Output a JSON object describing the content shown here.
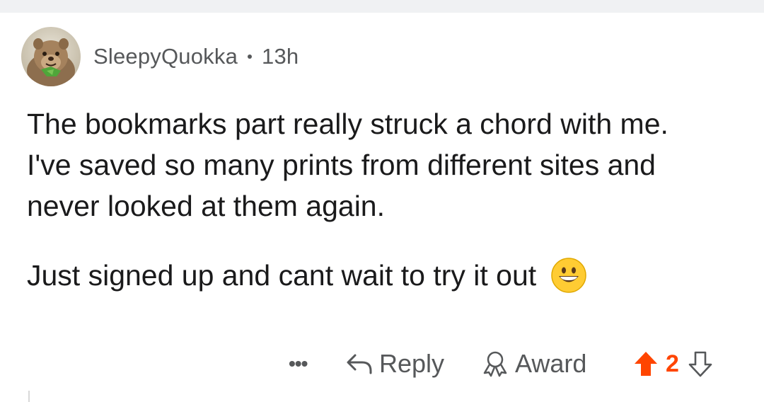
{
  "comment": {
    "username": "SleepyQuokka",
    "timestamp": "13h",
    "body_paragraphs": [
      "The bookmarks part really struck a chord with me. I've saved so many prints from different sites and never looked at them again.",
      "Just signed up and cant wait to try it out"
    ],
    "emoji": "grinning-face"
  },
  "actions": {
    "more_label": "•••",
    "reply_label": "Reply",
    "award_label": "Award",
    "vote_count": "2",
    "upvote_state": "upvoted"
  },
  "colors": {
    "upvote_accent": "#ff4500",
    "muted_text": "#56585a",
    "body_text": "#1a1a1b",
    "emoji_fill": "#ffcc33"
  }
}
